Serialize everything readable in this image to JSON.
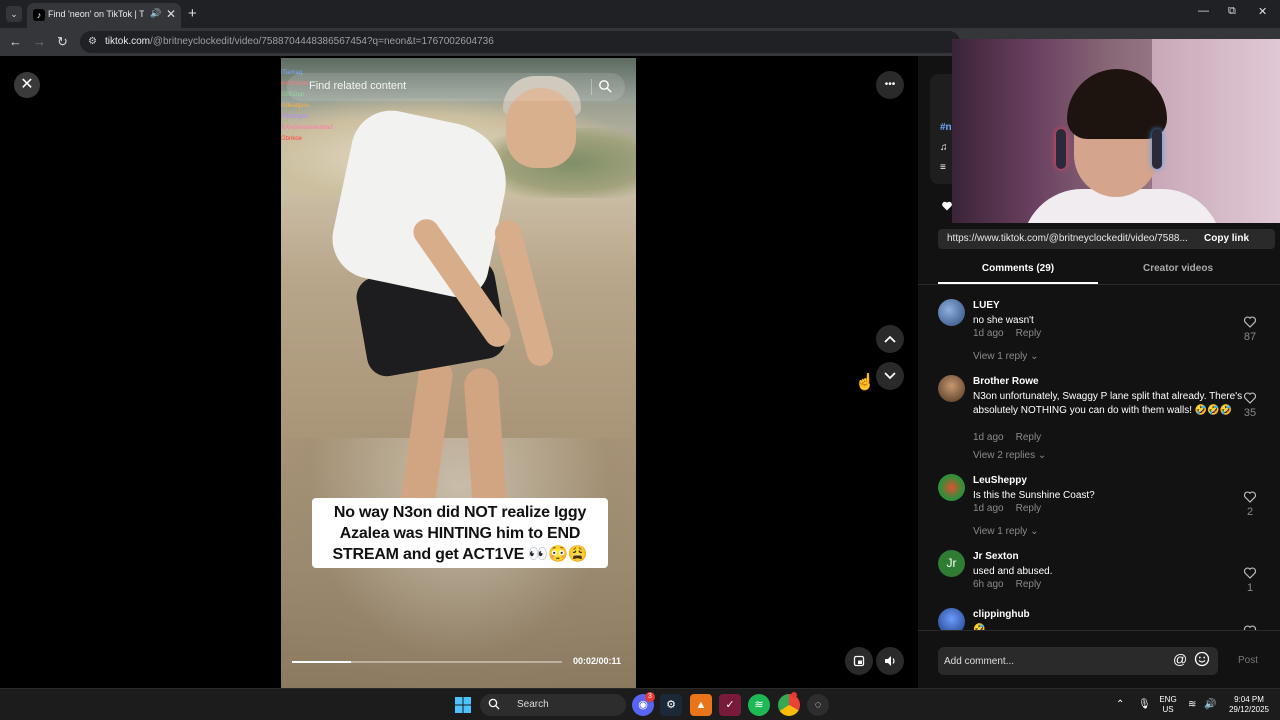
{
  "browser": {
    "tab_title": "Find 'neon' on TikTok | TikTok",
    "url_host": "tiktok.com",
    "url_path": "/@britneyclockedit/video/7588704448386567454?q=neon&t=1767002604736",
    "new_tab": "+",
    "minimize": "—",
    "restore": "⧉",
    "close": "✕",
    "back": "←",
    "forward": "→",
    "reload": "↻"
  },
  "video": {
    "search_placeholder": "Find related content",
    "caption_lines": [
      "No way N3on did NOT realize Iggy",
      "Azalea was HINTING him to END",
      "STREAM and get ACT1VE 👀😳😩"
    ],
    "time": "00:02/00:11",
    "progress_fraction": 0.22,
    "chat_overlay": [
      {
        "text": "iTiamaq",
        "color": "#7aa7ff"
      },
      {
        "text": "ex01seum",
        "color": "#ff6b6b"
      },
      {
        "text": "SBEGun",
        "color": "#8fd18f"
      },
      {
        "text": "Gdeadpoo",
        "color": "#ffb347"
      },
      {
        "text": "Y3bchgod",
        "color": "#b38cff"
      },
      {
        "text": "XXletmeseeleoblad",
        "color": "#ff7aa8"
      },
      {
        "text": "Gbnkoe",
        "color": "#ff4444"
      }
    ]
  },
  "controls": {
    "close": "✕",
    "more": "•••",
    "prev": "⌃",
    "next": "⌄"
  },
  "panel": {
    "desc_fragments": [
      "#n",
      "♫",
      "≡"
    ],
    "share_url": "https://www.tiktok.com/@britneyclockedit/video/7588...",
    "copy_link": "Copy link",
    "tabs": {
      "comments": "Comments (29)",
      "creator": "Creator videos"
    },
    "comments": [
      {
        "user": "LUEY",
        "text": "no she wasn't",
        "time": "1d ago",
        "reply": "Reply",
        "view": "View 1 reply ⌄",
        "likes": "87",
        "avatar_color": "#3c5a8a",
        "initials": ""
      },
      {
        "user": "Brother Rowe",
        "text": "N3on unfortunately, Swaggy P lane split that already. There's absolutely NOTHING you can do with them walls! 🤣🤣🤣",
        "time": "1d ago",
        "reply": "Reply",
        "view": "View 2 replies ⌄",
        "likes": "35",
        "avatar_color": "#5a4632",
        "initials": ""
      },
      {
        "user": "LeuSheppy",
        "text": "Is this the Sunshine Coast?",
        "time": "1d ago",
        "reply": "Reply",
        "view": "View 1 reply ⌄",
        "likes": "2",
        "avatar_color": "#2f8f3a",
        "initials": ""
      },
      {
        "user": "Jr Sexton",
        "text": "used and abused.",
        "time": "6h ago",
        "reply": "Reply",
        "view": "",
        "likes": "1",
        "avatar_color": "#2e7d32",
        "initials": "Jr"
      },
      {
        "user": "clippinghub",
        "text": "🤣",
        "time": "",
        "reply": "",
        "view": "",
        "likes": "",
        "avatar_color": "#1f3a7a",
        "initials": ""
      }
    ],
    "comment_placeholder": "Add comment...",
    "at_symbol": "@",
    "post": "Post"
  },
  "taskbar": {
    "search": "Search",
    "discord_badge": "3",
    "lang_top": "ENG",
    "lang_bottom": "US",
    "time": "9:04 PM",
    "date": "29/12/2025",
    "tray_chevron": "⌃"
  },
  "colors": {
    "accent": "#fe2c55",
    "panel_bg": "#121212"
  }
}
